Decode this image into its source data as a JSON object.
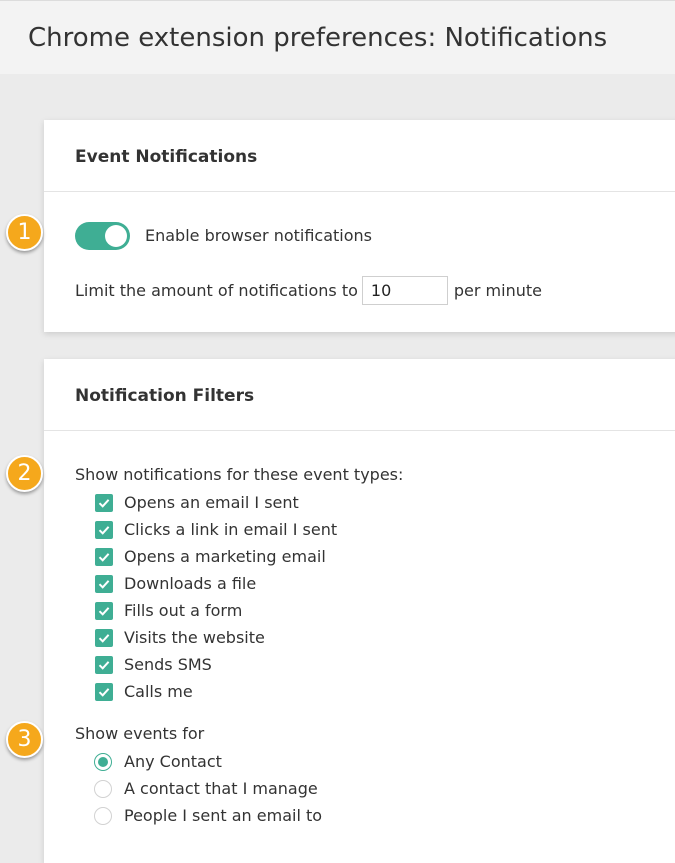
{
  "page": {
    "title": "Chrome extension preferences: Notifications"
  },
  "event_notifications": {
    "title": "Event Notifications",
    "enable_label": "Enable browser notifications",
    "enable_state": true,
    "limit_prefix": "Limit the amount of notifications to",
    "limit_value": "10",
    "limit_suffix": "per minute"
  },
  "notification_filters": {
    "title": "Notification Filters",
    "event_types_label": "Show notifications for these event types:",
    "event_types": [
      {
        "label": "Opens an email I sent",
        "checked": true
      },
      {
        "label": "Clicks a link in email I sent",
        "checked": true
      },
      {
        "label": "Opens a marketing email",
        "checked": true
      },
      {
        "label": "Downloads a file",
        "checked": true
      },
      {
        "label": "Fills out a form",
        "checked": true
      },
      {
        "label": "Visits the website",
        "checked": true
      },
      {
        "label": "Sends SMS",
        "checked": true
      },
      {
        "label": "Calls me",
        "checked": true
      }
    ],
    "show_events_label": "Show events for",
    "show_events_options": [
      {
        "label": "Any Contact",
        "selected": true
      },
      {
        "label": "A contact that I manage",
        "selected": false
      },
      {
        "label": "People I sent an email to",
        "selected": false
      }
    ]
  },
  "callouts": [
    "1",
    "2",
    "3"
  ],
  "colors": {
    "accent": "#3fae94",
    "callout": "#f5a81c"
  }
}
